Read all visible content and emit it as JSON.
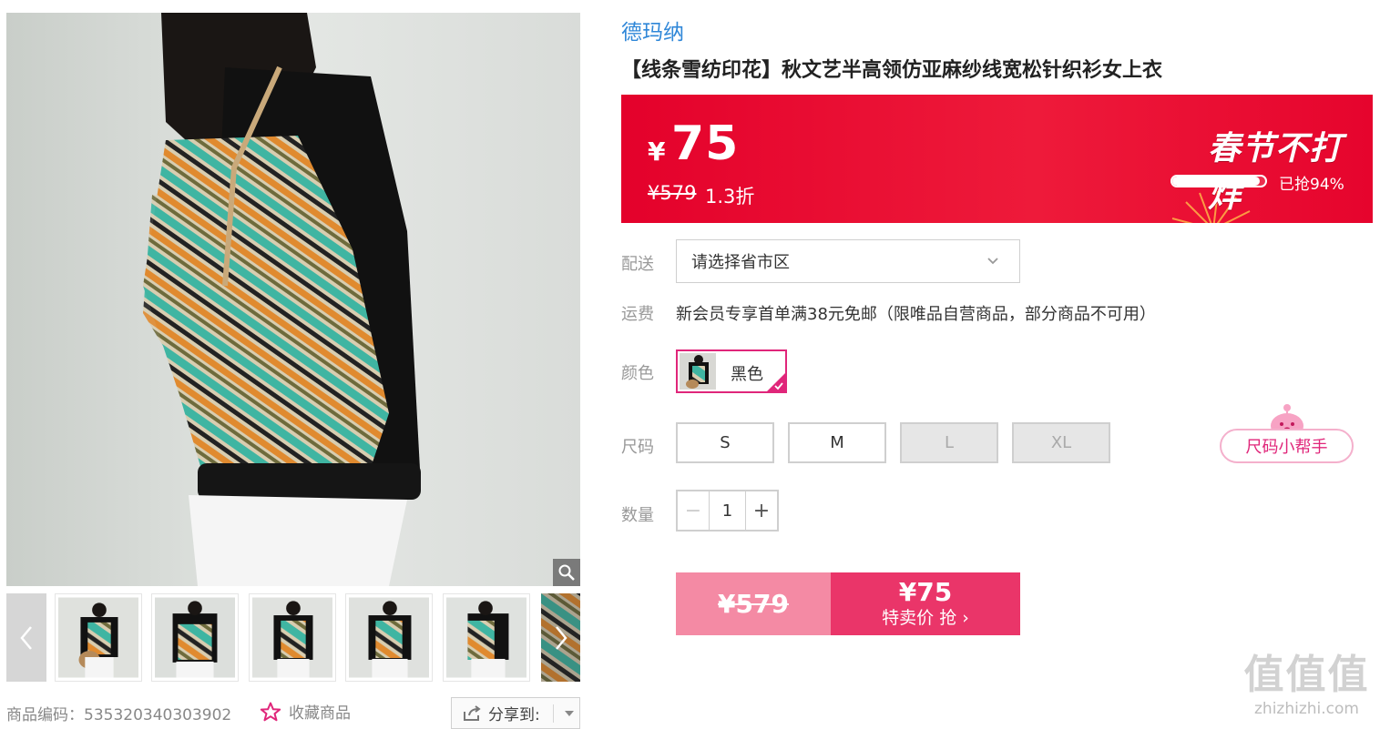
{
  "product": {
    "brand": "德玛纳",
    "title": "【线条雪纺印花】秋文艺半高领仿亚麻纱线宽松针织衫女上衣",
    "sku_label": "商品编码：535320340303902",
    "favorite_label": "收藏商品",
    "share_label": "分享到:"
  },
  "price_banner": {
    "currency": "¥",
    "price": "75",
    "original_price": "¥579",
    "discount": "1.3折",
    "promo_text": "春节不打烊",
    "sold_text": "已抢94%",
    "sold_fraction": 0.94
  },
  "delivery": {
    "label": "配送",
    "placeholder": "请选择省市区"
  },
  "shipping": {
    "label": "运费",
    "text": "新会员专享首单满38元免邮（限唯品自营商品，部分商品不可用）"
  },
  "color": {
    "label": "颜色",
    "selected": "黑色"
  },
  "size": {
    "label": "尺码",
    "options": [
      {
        "label": "S",
        "available": true
      },
      {
        "label": "M",
        "available": true
      },
      {
        "label": "L",
        "available": false
      },
      {
        "label": "XL",
        "available": false
      }
    ],
    "helper": "尺码小帮手"
  },
  "quantity": {
    "label": "数量",
    "minus": "−",
    "value": "1",
    "plus": "+"
  },
  "buy": {
    "original": "¥579",
    "price": "¥75",
    "action": "特卖价 抢 ›"
  },
  "gallery": {
    "thumb_count": 6
  },
  "watermark": {
    "big": "值值值",
    "small": "zhizhizhi.com"
  },
  "colors": {
    "accent_red": "#e4012b",
    "pink": "#e0267a",
    "buy_pink": "#ea3569",
    "brand_blue": "#2f87d8"
  }
}
